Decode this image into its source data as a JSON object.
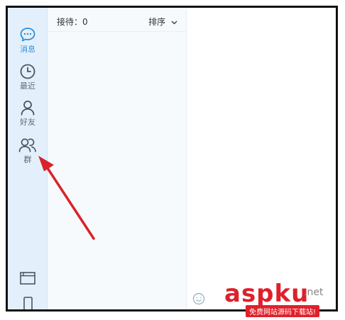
{
  "sidebar": {
    "items": [
      {
        "label": "消息",
        "icon": "chat-bubble-icon",
        "active": true
      },
      {
        "label": "最近",
        "icon": "clock-icon"
      },
      {
        "label": "好友",
        "icon": "person-icon"
      },
      {
        "label": "群",
        "icon": "group-icon"
      }
    ],
    "bottom_icons": [
      "window-icon",
      "phone-icon"
    ]
  },
  "list_header": {
    "reception": "接待：0",
    "sort_label": "排序"
  },
  "watermark": {
    "main": "aspku",
    "domain": ".net",
    "subtitle": "免费网站源码下载站!"
  },
  "colors": {
    "accent": "#2f8fdd",
    "sidebar_bg": "#e3f0fb",
    "arrow": "#d8232a"
  }
}
